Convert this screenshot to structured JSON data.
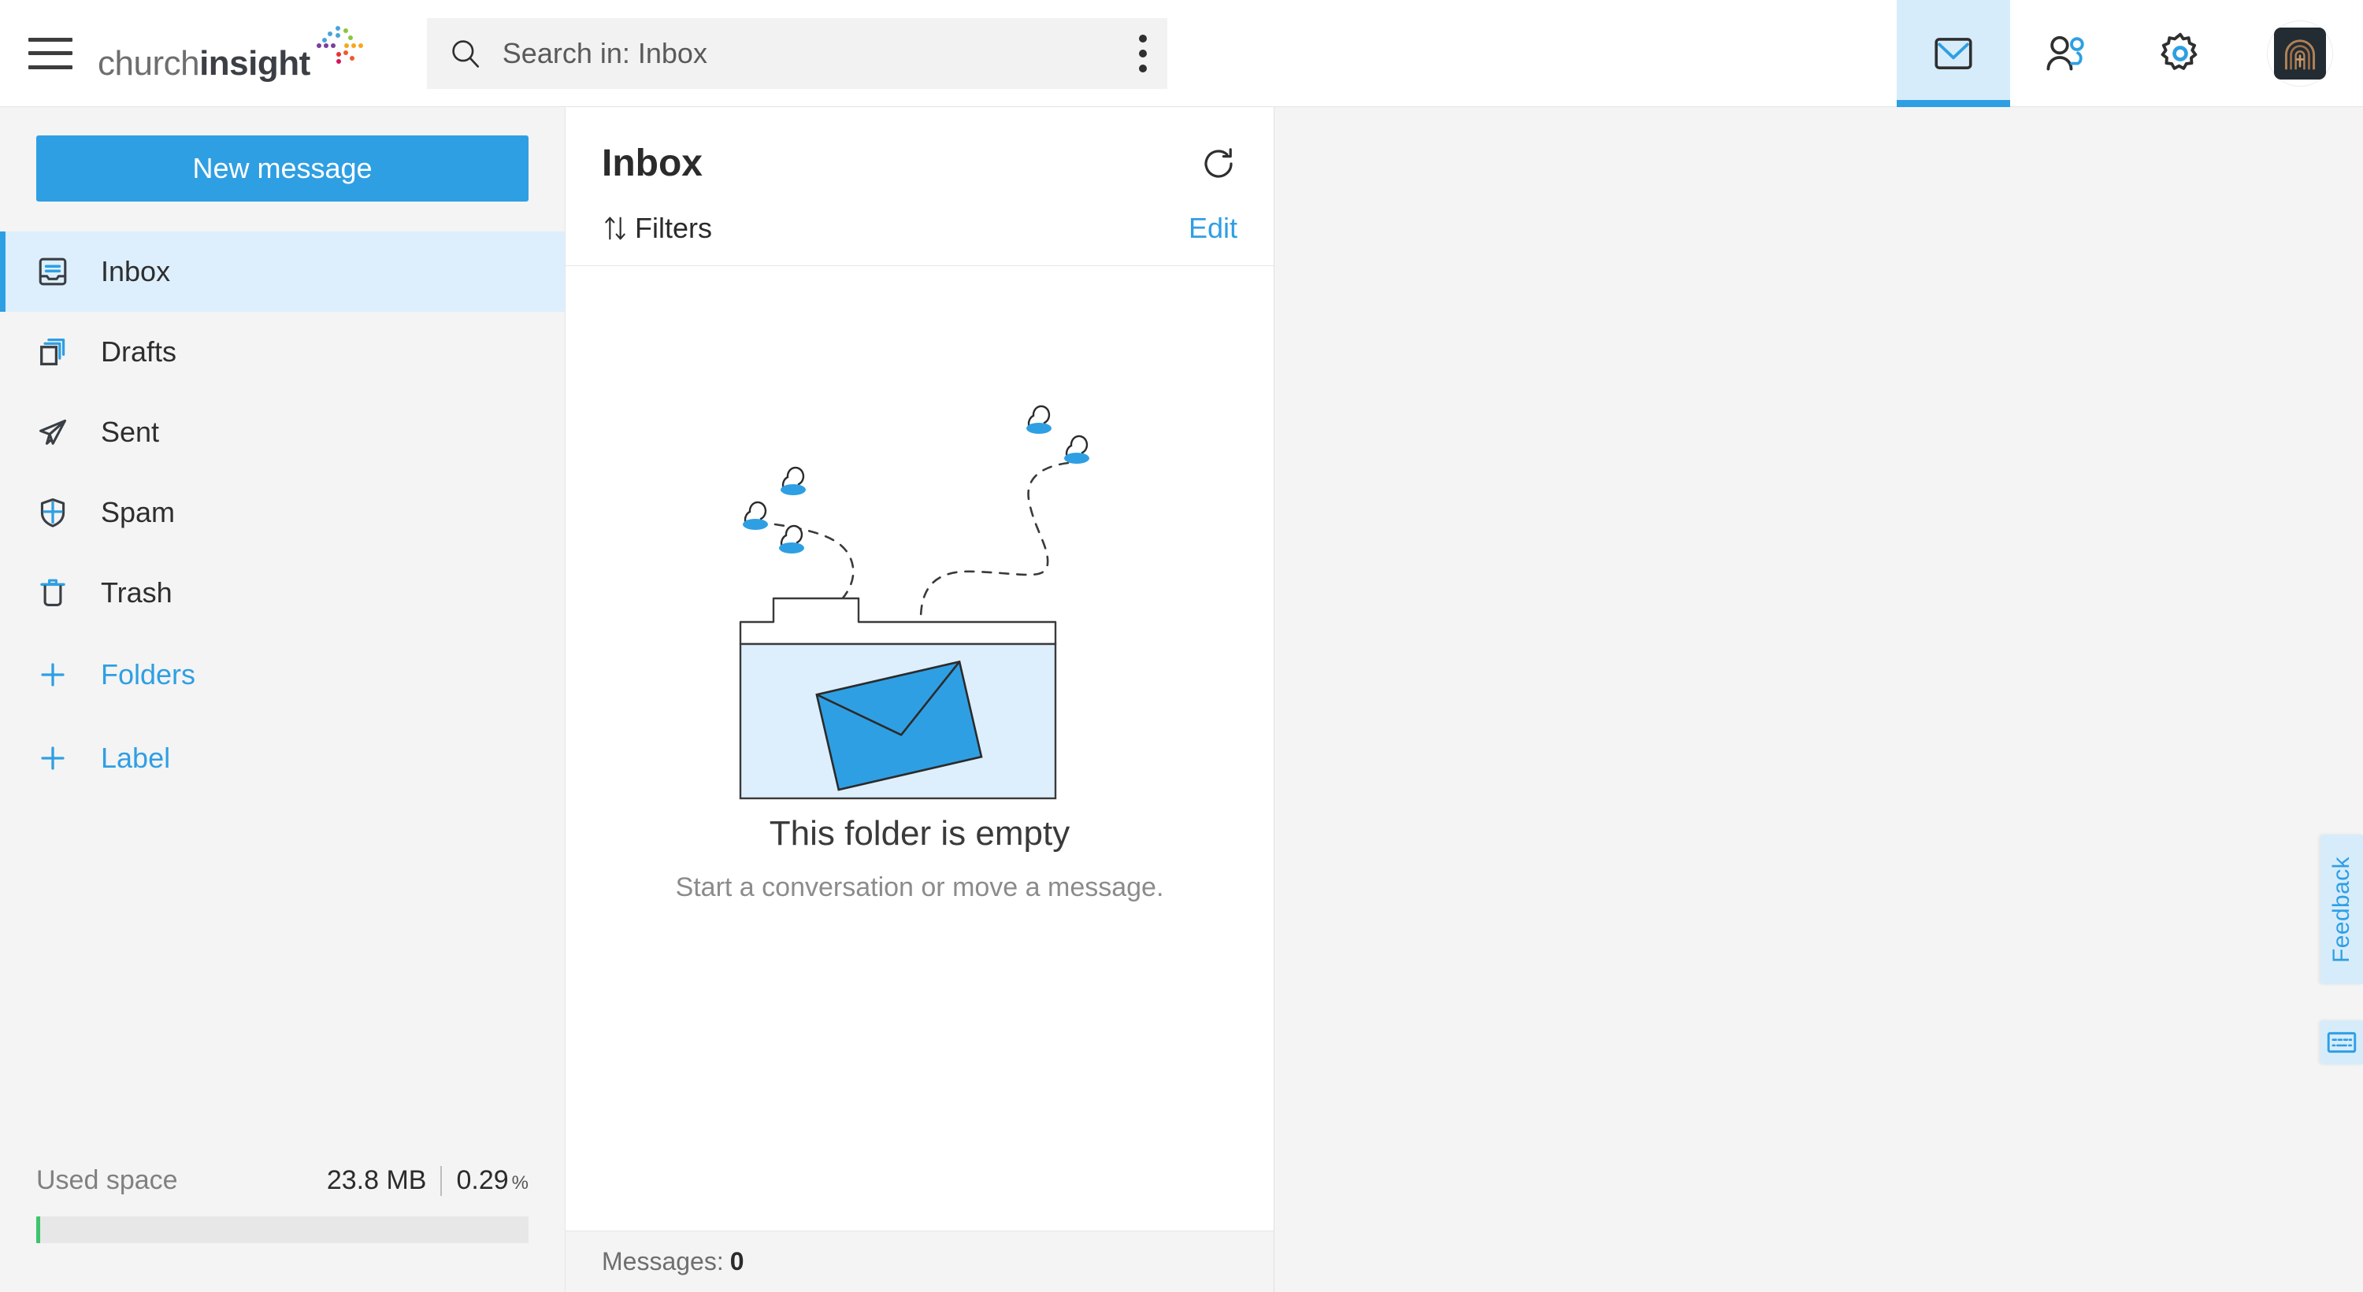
{
  "app": {
    "brand_word_light": "church",
    "brand_word_bold": "insight",
    "accent_blue": "#2f9fe3",
    "accent_blue_light": "#d6ecfb",
    "panel_gray": "#f4f4f4",
    "green": "#3ec46d"
  },
  "topbar": {
    "menu_label": "menu-toggle",
    "search": {
      "placeholder": "Search in: Inbox",
      "value": "",
      "icon": "search-icon",
      "options_icon": "kebab-menu-icon"
    },
    "actions": [
      {
        "name": "mail",
        "icon": "mail-icon",
        "active": true
      },
      {
        "name": "contacts",
        "icon": "contacts-icon",
        "active": false
      },
      {
        "name": "settings",
        "icon": "gear-icon",
        "active": false
      }
    ],
    "avatar": {
      "name": "user-avatar",
      "icon": "church-arch-icon"
    }
  },
  "sidebar": {
    "compose_label": "New message",
    "items": [
      {
        "label": "Inbox",
        "icon": "inbox-icon",
        "active": true,
        "link": false
      },
      {
        "label": "Drafts",
        "icon": "drafts-icon",
        "active": false,
        "link": false
      },
      {
        "label": "Sent",
        "icon": "sent-icon",
        "active": false,
        "link": false
      },
      {
        "label": "Spam",
        "icon": "spam-icon",
        "active": false,
        "link": false
      },
      {
        "label": "Trash",
        "icon": "trash-icon",
        "active": false,
        "link": false
      },
      {
        "label": "Folders",
        "icon": "plus-icon",
        "active": false,
        "link": true
      },
      {
        "label": "Label",
        "icon": "plus-icon",
        "active": false,
        "link": true
      }
    ],
    "storage": {
      "label": "Used space",
      "size": "23.8 MB",
      "percent": "0.29",
      "percent_symbol": "%",
      "fill_ratio": 0.0029
    }
  },
  "list_panel": {
    "title": "Inbox",
    "refresh_icon": "refresh-icon",
    "filters_label": "Filters",
    "filters_icon": "sort-arrows-icon",
    "edit_label": "Edit",
    "empty_state": {
      "illustration": "empty-folder-with-envelope-illustration",
      "title": "This folder is empty",
      "subtitle": "Start a conversation or move a message."
    },
    "footer": {
      "label": "Messages:",
      "count": "0"
    }
  },
  "side_rail": {
    "feedback_label": "Feedback",
    "keyboard_icon": "keyboard-icon"
  }
}
